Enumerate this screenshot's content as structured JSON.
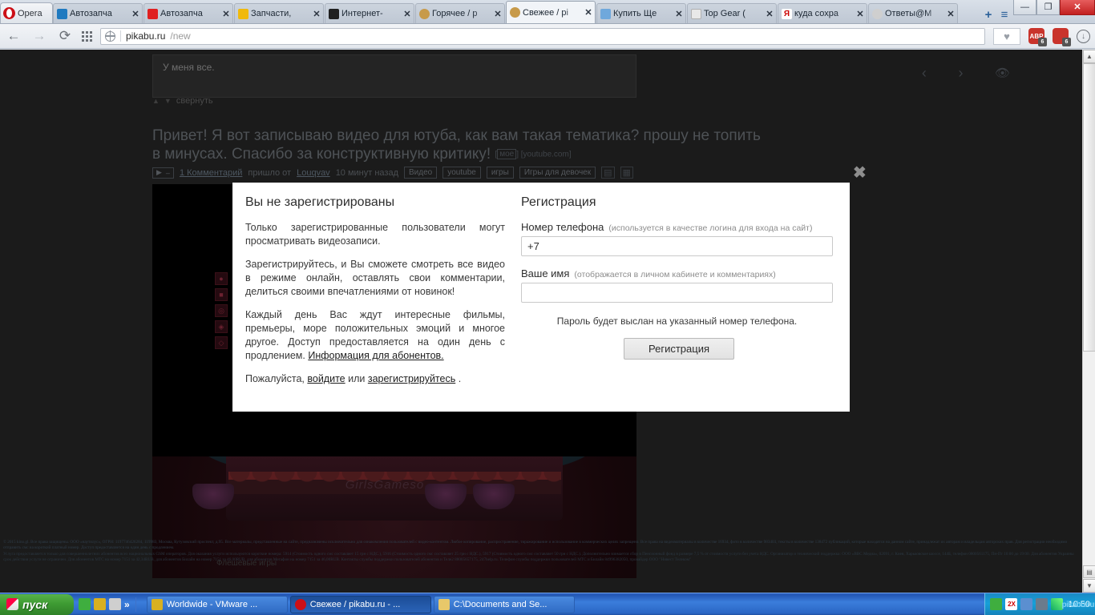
{
  "browser": {
    "name": "Opera",
    "menu_button_label": "Opera",
    "tabs": [
      {
        "title": "Автозапча",
        "favicon": "recycle-icon",
        "color": "#1f7ac0",
        "active": false
      },
      {
        "title": "Автозапча",
        "favicon": "gear-icon",
        "color": "#e02020",
        "active": false
      },
      {
        "title": "Запчасти,",
        "favicon": "balls-icon",
        "color": "#f0b90b",
        "active": false
      },
      {
        "title": "Интернет-",
        "favicon": "person-icon",
        "color": "#202020",
        "active": false
      },
      {
        "title": "Горячее / p",
        "favicon": "pikabu-icon",
        "color": "#c79a4a",
        "active": false
      },
      {
        "title": "Свежее / pi",
        "favicon": "pikabu-icon",
        "color": "#c79a4a",
        "active": true
      },
      {
        "title": "Купить Ще",
        "favicon": "shop-icon",
        "color": "#6fa8dc",
        "active": false
      },
      {
        "title": "Top Gear (",
        "favicon": "doc-icon",
        "color": "#d8d8d8",
        "active": false
      },
      {
        "title": "куда сохра",
        "favicon": "yandex-icon",
        "color": "#cc0000",
        "active": false
      },
      {
        "title": "Ответы@M",
        "favicon": "mail-icon",
        "color": "#7a7a7a",
        "active": false
      }
    ],
    "new_tab_label": "+",
    "tab_menu_label": "≡",
    "window_controls": {
      "minimize": "—",
      "maximize": "❐",
      "close": "✕"
    },
    "nav": {
      "back": "←",
      "forward": "→",
      "reload": "⟳",
      "speed_dial": "speed-dial-icon",
      "url_domain": "pikabu.ru",
      "url_path": "/new",
      "url_full": "pikabu.ru/new",
      "bookmark_heart": "♥",
      "adblock_label": "ABP",
      "adblock_count": "6",
      "noscript_label": "⛔",
      "noscript_count": "6",
      "download": "↓"
    }
  },
  "page": {
    "comment_text": "У меня все.",
    "collapse_label": "свернуть",
    "post_title": "Привет! Я вот записываю видео для ютуба, как вам такая тематика? прошу не топить в минусах. Спасибо за конструктивную критику!",
    "post_title_tags": [
      "мое",
      "youtube.com"
    ],
    "meta": {
      "play": "▶",
      "comments_link": "1 Комментарий",
      "came_from": "пришло от",
      "author": "Louqvav",
      "time": "10 минут назад",
      "tags": [
        "Видео",
        "youtube",
        "игры",
        "Игры для девочек"
      ]
    },
    "poster_caption": "Флешевые игры",
    "poster_watermark": "GirlsGameso",
    "pager": {
      "prev": "‹",
      "next": "›",
      "eye": "👁"
    },
    "legal": [
      "© 2015 kino.gl. Все права защищены. ООО «наутилус», ОГРН: 1197746426284, 119983, Москва, Кутузовский проспект, д.95. Все материалы, представленные на сайте, предназначены исключительно для ознакомления пользователей с видео-контентом. Любое копирование, распространение, тиражирование и использование в коммерческих целях запрещено. Все права на видеоматериалы в количестве 16934, фото в количестве 983403, тексты в количестве 138472 публикаций, которые находятся на данном сайте, принадлежат их авторам и владельцам авторских прав. Для регистрации необходимо отправить смс на короткий платный номер. Доступ предоставляется на один день с продлением.",
      "Услуга предоставляется только для совершеннолетних абонентов всех национальных GSM операторов. Для оказания услуги используются короткие номера: 5914 (Стоимость одного смс составляет 15 грн с НДС.), 5916 (Стоимость одного смс составляет 25 грн с НДС.), 5917 (Стоимость одного смс составляет 50 грн с НДС.). Дополнительно взимается сбор в Пенсионный фонд в размере 7,5 % от стоимости услуги без учета НДС. Организатор и технический поддержка: ООО «ВВС Медиа», 02091, г. Киев, Харьковское шоссе, 144Б, телефон 0800561175, Пн-Пт 10:00 до 19:00. Для абонентов Украины срок действия услуги не ограничен. Для абонентов МТС на номер 7151 за 42,34RUB, для абонентов Билайн на номер 7151 за 46,00RUB, для абонентов Мегафон на номер 7151 за 46,00RUB. Контакты службы поддержки пользователей абонентов и Теле2 88005657175, 247help.ru. Телефон службы поддержки пользователей МТС и Билайн 84996382050, провайдер ООО \"Нивест Телеком\""
    ]
  },
  "modal": {
    "close_label": "✖",
    "left": {
      "heading": "Вы не зарегистрированы",
      "paragraphs": [
        "Только зарегистрированные пользователи могут просматривать видеозаписи.",
        "Зарегистрируйтесь, и Вы сможете смотреть все видео в режиме онлайн, оставлять свои комментарии, делиться своими впечатлениями от новинок!"
      ],
      "para3_prefix": "Каждый день Вас ждут интересные фильмы, премьеры, море положительных эмоций и многое другое. Доступ предоставляется на один день с продлением. ",
      "para3_link": "Информация для абонентов.",
      "para4_prefix": "Пожалуйста, ",
      "para4_login": "войдите",
      "para4_middle": " или ",
      "para4_register": "зарегистрируйтесь",
      "para4_suffix": " ."
    },
    "right": {
      "heading": "Регистрация",
      "phone_label": "Номер телефона",
      "phone_hint": "(используется в качестве логина для входа на сайт)",
      "phone_value": "+7",
      "name_label": "Ваше имя",
      "name_hint": "(отображается в личном кабинете и комментариях)",
      "name_value": "",
      "name_placeholder": "",
      "note": "Пароль будет выслан на указанный номер телефона.",
      "submit_label": "Регистрация"
    }
  },
  "taskbar": {
    "start_label": "пуск",
    "quick_launch": [
      "clover-icon",
      "bug-icon",
      "calculator-icon"
    ],
    "quick_launch_more": "»",
    "tasks": [
      {
        "label": "Worldwide - VMware ...",
        "icon": "vmware-icon",
        "active": false
      },
      {
        "label": "Свежее / pikabu.ru - ...",
        "icon": "opera-icon",
        "active": true
      },
      {
        "label": "C:\\Documents and Se...",
        "icon": "folder-icon",
        "active": false
      }
    ],
    "tray_icons": [
      "clover-icon",
      "2x-icon",
      "monitor-icon",
      "network-icon",
      "signal-icon"
    ],
    "clock": "10:50",
    "clock_watermark": "pikabu.ru"
  }
}
